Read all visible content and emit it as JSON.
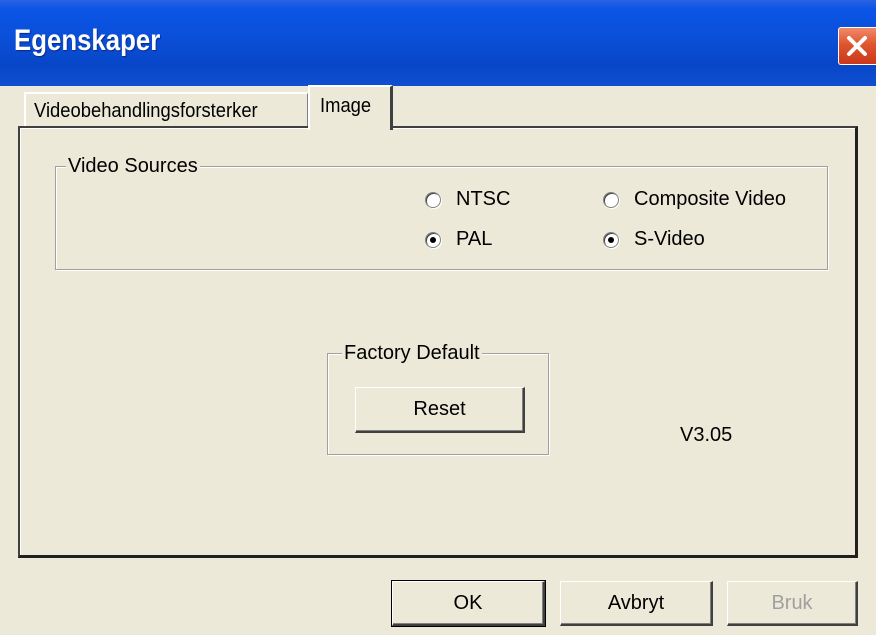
{
  "window": {
    "title": "Egenskaper",
    "close_icon": "close-icon",
    "title_bar_color": "#0a4fd8",
    "close_button_color": "#e0552f"
  },
  "tabs": [
    {
      "label": "Videobehandlingsforsterker",
      "active": false
    },
    {
      "label": "Image",
      "active": true
    }
  ],
  "video_sources": {
    "legend": "Video Sources",
    "options": [
      {
        "label": "NTSC",
        "checked": false
      },
      {
        "label": "PAL",
        "checked": true
      },
      {
        "label": "Composite Video",
        "checked": false
      },
      {
        "label": "S-Video",
        "checked": true
      }
    ]
  },
  "factory_default": {
    "legend": "Factory Default",
    "reset_label": "Reset"
  },
  "version": "V3.05",
  "buttons": {
    "ok": "OK",
    "cancel": "Avbryt",
    "apply": "Bruk",
    "apply_disabled": true
  }
}
